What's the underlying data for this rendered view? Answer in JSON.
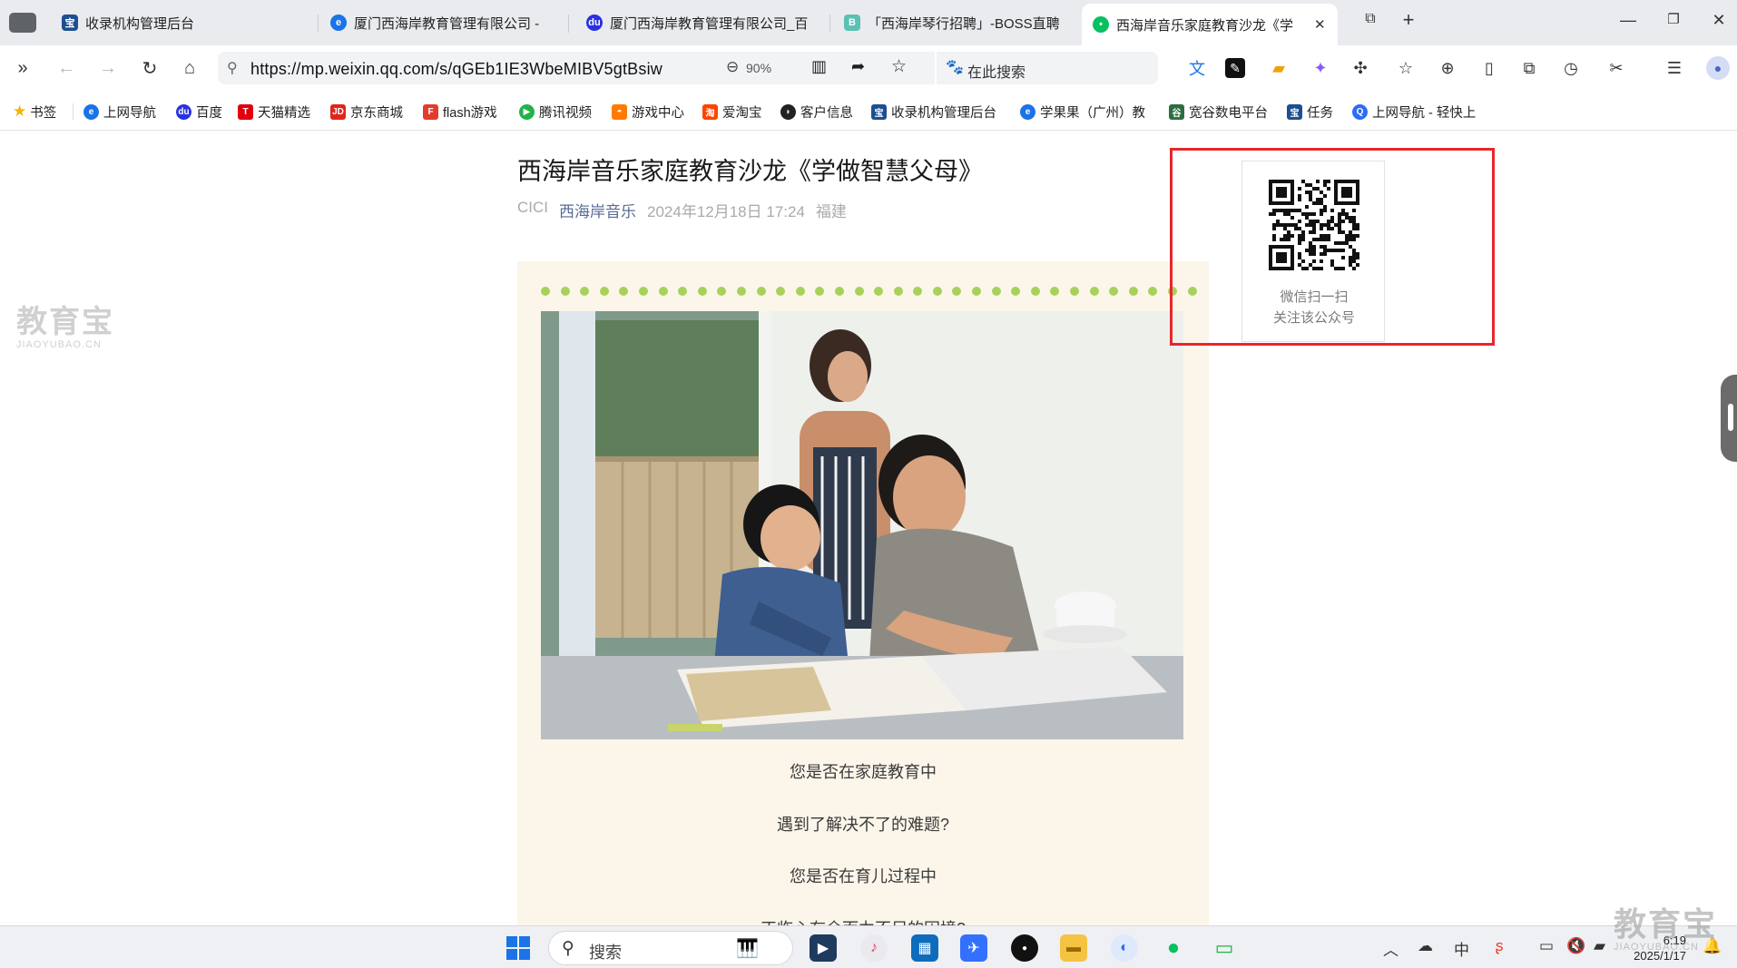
{
  "tabs": [
    {
      "label": "收录机构管理后台",
      "icon": "admin-icon"
    },
    {
      "label": "厦门西海岸教育管理有限公司 - ",
      "icon": "edge-icon"
    },
    {
      "label": "厦门西海岸教育管理有限公司_百",
      "icon": "baidu-paw-icon"
    },
    {
      "label": "「西海岸琴行招聘」-BOSS直聘",
      "icon": "boss-icon"
    },
    {
      "label": "西海岸音乐家庭教育沙龙《学",
      "icon": "wechat-icon"
    }
  ],
  "navbar": {
    "url": "https://mp.weixin.qq.com/s/qGEb1IE3WbeMIBV5gtBsiw",
    "zoom": "90%",
    "search_placeholder": "在此搜索"
  },
  "bookmarks": [
    {
      "label": "书签",
      "color": "#f5b400"
    },
    {
      "label": "上网导航",
      "color": "#1a73e8"
    },
    {
      "label": "百度",
      "color": "#2932e1"
    },
    {
      "label": "天猫精选",
      "color": "#e0000f"
    },
    {
      "label": "京东商城",
      "color": "#e1251b"
    },
    {
      "label": "flash游戏",
      "color": "#e33b2e"
    },
    {
      "label": "腾讯视频",
      "color": "#20b34a"
    },
    {
      "label": "游戏中心",
      "color": "#ff7a00"
    },
    {
      "label": "爱淘宝",
      "color": "#ff4400"
    },
    {
      "label": "客户信息",
      "color": "#222222"
    },
    {
      "label": "收录机构管理后台",
      "color": "#1d4f91"
    },
    {
      "label": "学果果（广州）教",
      "color": "#1a73e8"
    },
    {
      "label": "宽谷数电平台",
      "color": "#2c6e3f"
    },
    {
      "label": "任务",
      "color": "#1d4f91"
    },
    {
      "label": "上网导航 - 轻快上",
      "color": "#2b6ef2"
    }
  ],
  "watermark": {
    "cn": "教育宝",
    "en": "JIAOYUBAO.CN"
  },
  "article": {
    "title": "西海岸音乐家庭教育沙龙《学做智慧父母》",
    "author": "CICI",
    "account": "西海岸音乐",
    "datetime": "2024年12月18日 17:24",
    "location": "福建",
    "paragraphs": [
      "您是否在家庭教育中",
      "遇到了解决不了的难题?",
      "您是否在育儿过程中",
      "正临心有余而力不足的困境?"
    ]
  },
  "qr": {
    "line1": "微信扫一扫",
    "line2": "关注该公众号"
  },
  "taskbar": {
    "search_label": "搜索",
    "time": "6:19",
    "date": "2025/1/17",
    "ime": "中"
  },
  "colors": {
    "accent_link": "#576b95",
    "card_bg": "#fcf6ea",
    "dot_green": "#a8d15a",
    "highlight_red": "#e8262b"
  }
}
